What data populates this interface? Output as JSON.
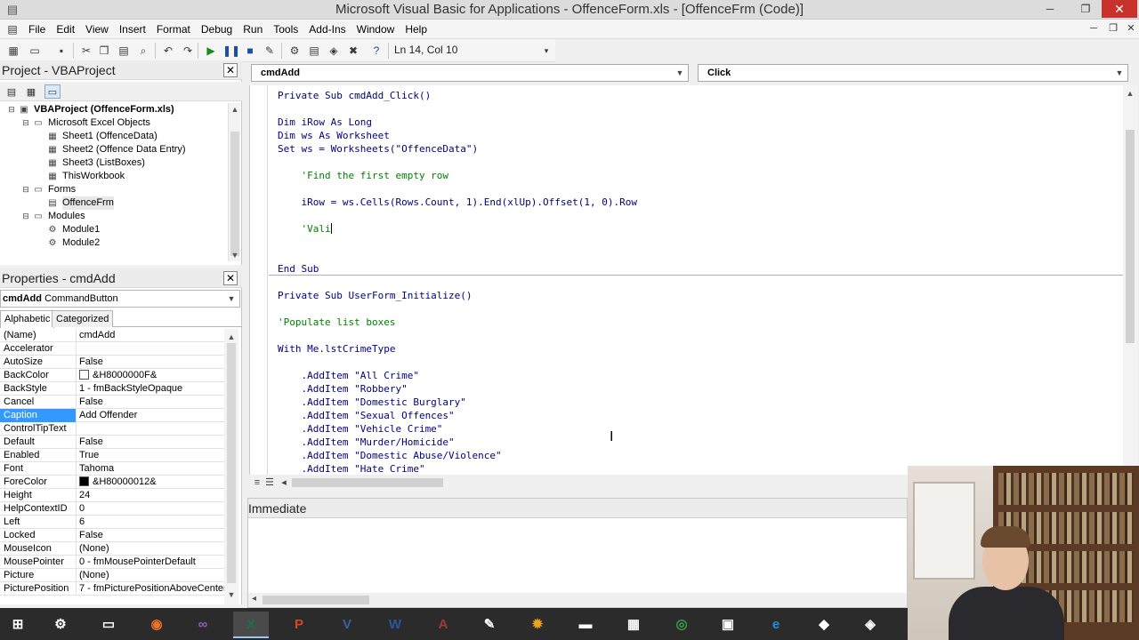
{
  "window": {
    "title": "Microsoft Visual Basic for Applications - OffenceForm.xls - [OffenceFrm (Code)]",
    "minimize": "─",
    "restore": "❐",
    "close": "✕"
  },
  "menu": {
    "items": [
      "File",
      "Edit",
      "View",
      "Insert",
      "Format",
      "Debug",
      "Run",
      "Tools",
      "Add-Ins",
      "Window",
      "Help"
    ],
    "mdi_minimize": "─",
    "mdi_restore": "❐",
    "mdi_close": "✕"
  },
  "toolbar": {
    "cursor_position": "Ln 14, Col 10"
  },
  "project": {
    "title": "Project - VBAProject",
    "close": "✕",
    "tree": [
      {
        "label": "VBAProject (OffenceForm.xls)",
        "bold": true,
        "expander": "⊟"
      },
      {
        "label": "Microsoft Excel Objects",
        "expander": "⊟"
      },
      {
        "label": "Sheet1 (OffenceData)"
      },
      {
        "label": "Sheet2 (Offence Data Entry)"
      },
      {
        "label": "Sheet3 (ListBoxes)"
      },
      {
        "label": "ThisWorkbook"
      },
      {
        "label": "Forms",
        "expander": "⊟"
      },
      {
        "label": "OffenceFrm",
        "selected": true
      },
      {
        "label": "Modules",
        "expander": "⊟"
      },
      {
        "label": "Module1"
      },
      {
        "label": "Module2"
      }
    ]
  },
  "properties": {
    "title": "Properties - cmdAdd",
    "close": "✕",
    "object_name": "cmdAdd",
    "object_type": "CommandButton",
    "tabs": [
      "Alphabetic",
      "Categorized"
    ],
    "rows": [
      {
        "name": "(Name)",
        "value": "cmdAdd"
      },
      {
        "name": "Accelerator",
        "value": ""
      },
      {
        "name": "AutoSize",
        "value": "False"
      },
      {
        "name": "BackColor",
        "value": "&H8000000F&",
        "swatch": "#ffffff"
      },
      {
        "name": "BackStyle",
        "value": "1 - fmBackStyleOpaque"
      },
      {
        "name": "Cancel",
        "value": "False"
      },
      {
        "name": "Caption",
        "value": "Add Offender",
        "selected": true
      },
      {
        "name": "ControlTipText",
        "value": ""
      },
      {
        "name": "Default",
        "value": "False"
      },
      {
        "name": "Enabled",
        "value": "True"
      },
      {
        "name": "Font",
        "value": "Tahoma"
      },
      {
        "name": "ForeColor",
        "value": "&H80000012&",
        "swatch": "#000000"
      },
      {
        "name": "Height",
        "value": "24"
      },
      {
        "name": "HelpContextID",
        "value": "0"
      },
      {
        "name": "Left",
        "value": "6"
      },
      {
        "name": "Locked",
        "value": "False"
      },
      {
        "name": "MouseIcon",
        "value": "(None)"
      },
      {
        "name": "MousePointer",
        "value": "0 - fmMousePointerDefault"
      },
      {
        "name": "Picture",
        "value": "(None)"
      },
      {
        "name": "PicturePosition",
        "value": "7 - fmPicturePositionAboveCenter"
      }
    ]
  },
  "code": {
    "object_combo": "cmdAdd",
    "procedure_combo": "Click",
    "lines": [
      {
        "text": "Private Sub cmdAdd_Click()",
        "kind": "keyword"
      },
      {
        "text": "Dim iRow As Long",
        "kind": "keyword"
      },
      {
        "text": "Dim ws As Worksheet",
        "kind": "keyword"
      },
      {
        "text": "Set ws = Worksheets(\"OffenceData\")",
        "kind": "keyword"
      },
      {
        "text": "    'Find the first empty row",
        "kind": "comment"
      },
      {
        "text": "    iRow = ws.Cells(Rows.Count, 1).End(xlUp).Offset(1, 0).Row",
        "kind": "keyword"
      },
      {
        "text": "    'Vali",
        "kind": "comment"
      },
      {
        "text": "End Sub",
        "kind": "keyword"
      },
      {
        "text": "Private Sub UserForm_Initialize()",
        "kind": "keyword"
      },
      {
        "text": "'Populate list boxes",
        "kind": "comment"
      },
      {
        "text": "With Me.lstCrimeType",
        "kind": "keyword"
      },
      {
        "text": "    .AddItem \"All Crime\"",
        "kind": "keyword"
      },
      {
        "text": "    .AddItem \"Robbery\"",
        "kind": "keyword"
      },
      {
        "text": "    .AddItem \"Domestic Burglary\"",
        "kind": "keyword"
      },
      {
        "text": "    .AddItem \"Sexual Offences\"",
        "kind": "keyword"
      },
      {
        "text": "    .AddItem \"Vehicle Crime\"",
        "kind": "keyword"
      },
      {
        "text": "    .AddItem \"Murder/Homicide\"",
        "kind": "keyword"
      },
      {
        "text": "    .AddItem \"Domestic Abuse/Violence\"",
        "kind": "keyword"
      },
      {
        "text": "    .AddItem \"Hate Crime\"",
        "kind": "keyword"
      }
    ]
  },
  "immediate": {
    "title": "Immediate"
  },
  "taskbar": {
    "items": [
      {
        "name": "start-button",
        "glyph": "⊞"
      },
      {
        "name": "taskbar-app-1",
        "glyph": "⚙"
      },
      {
        "name": "taskbar-explorer",
        "glyph": "▭"
      },
      {
        "name": "taskbar-firefox",
        "glyph": "◉"
      },
      {
        "name": "taskbar-visual-studio",
        "glyph": "∞"
      },
      {
        "name": "taskbar-excel",
        "glyph": "X"
      },
      {
        "name": "taskbar-powerpoint",
        "glyph": "P"
      },
      {
        "name": "taskbar-visio",
        "glyph": "V"
      },
      {
        "name": "taskbar-word",
        "glyph": "W"
      },
      {
        "name": "taskbar-access",
        "glyph": "A"
      },
      {
        "name": "taskbar-tool",
        "glyph": "✎"
      },
      {
        "name": "taskbar-settings",
        "glyph": "✹"
      },
      {
        "name": "taskbar-terminal",
        "glyph": "▬"
      },
      {
        "name": "taskbar-calculator",
        "glyph": "▦"
      },
      {
        "name": "taskbar-chrome",
        "glyph": "◎"
      },
      {
        "name": "taskbar-project",
        "glyph": "▣"
      },
      {
        "name": "taskbar-ie",
        "glyph": "e"
      },
      {
        "name": "taskbar-app-2",
        "glyph": "◆"
      },
      {
        "name": "taskbar-app-3",
        "glyph": "◈"
      }
    ],
    "colors": {
      "taskbar-firefox": "#e8722a",
      "taskbar-visual-studio": "#8e5fc1",
      "taskbar-excel": "#1f7244",
      "taskbar-powerpoint": "#d24726",
      "taskbar-visio": "#3c5fa8",
      "taskbar-word": "#2b579a",
      "taskbar-access": "#a4373a",
      "taskbar-settings": "#f0a020",
      "taskbar-chrome": "#3d9c4a",
      "taskbar-ie": "#1e90d8"
    }
  }
}
